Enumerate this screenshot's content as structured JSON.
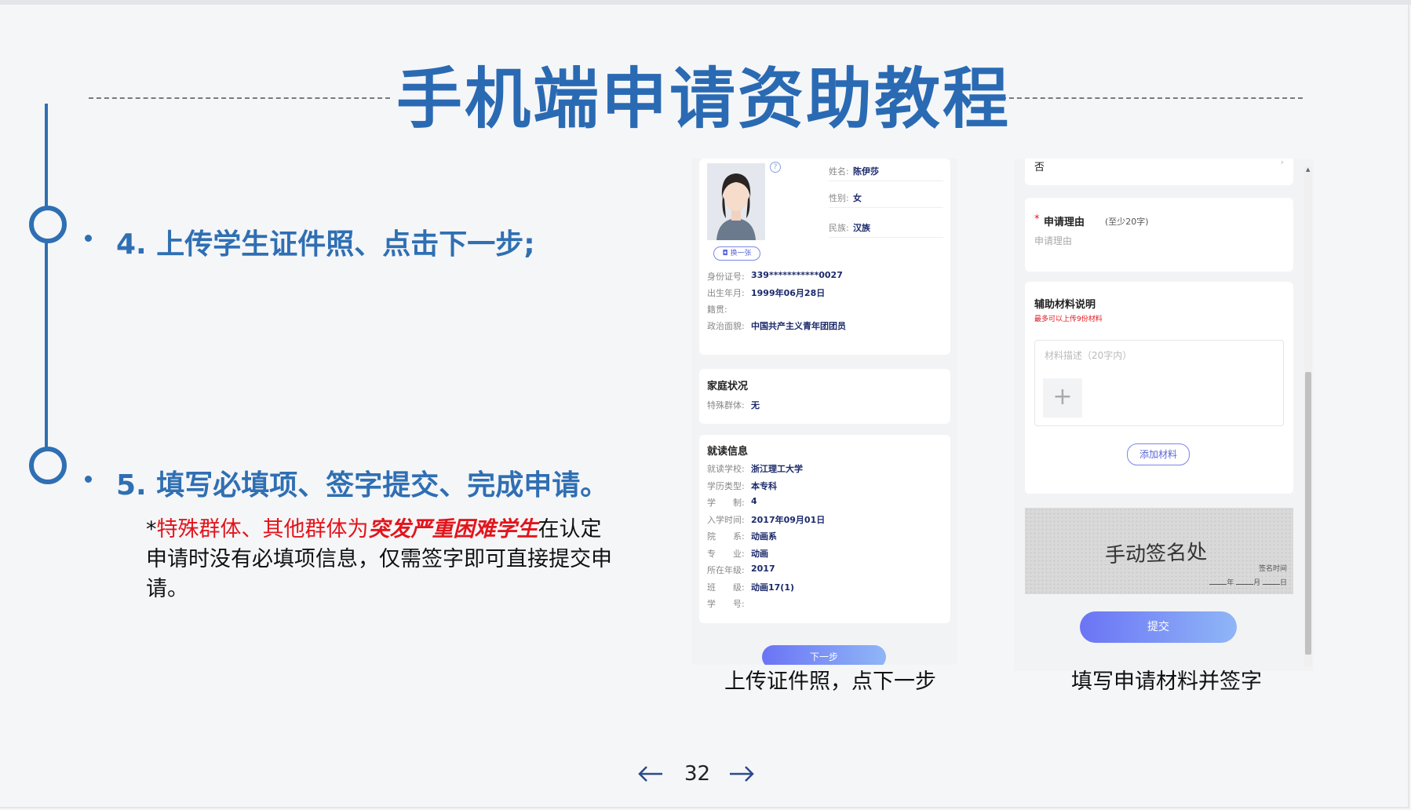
{
  "title": "手机端申请资助教程",
  "steps": [
    {
      "text": "4. 上传学生证件照、点击下一步;"
    },
    {
      "text": "5. 填写必填项、签字提交、完成申请。"
    }
  ],
  "note": {
    "star": "*",
    "red1": "特殊群体、其他群体为",
    "red_bold": "突发严重困难学生",
    "rest": "在认定申请时没有必填项信息，仅需签字即可直接提交申请。"
  },
  "shot1": {
    "help_icon": "?",
    "name_label": "姓名:",
    "name_value": "陈伊莎",
    "gender_label": "性别:",
    "gender_value": "女",
    "ethnic_label": "民族:",
    "ethnic_value": "汉族",
    "photo_button": "换一张",
    "id_label": "身份证号:",
    "id_value": "339***********0027",
    "birth_label": "出生年月:",
    "birth_value": "1999年06月28日",
    "native_label": "籍贯:",
    "political_label": "政治面貌:",
    "political_value": "中国共产主义青年团团员",
    "family_title": "家庭状况",
    "group_label": "特殊群体:",
    "group_value": "无",
    "study_title": "就读信息",
    "study_rows": [
      {
        "label": "就读学校:",
        "value": "浙江理工大学"
      },
      {
        "label": "学历类型:",
        "value": "本专科"
      },
      {
        "label": "学　　制:",
        "value": "4"
      },
      {
        "label": "入学时间:",
        "value": "2017年09月01日"
      },
      {
        "label": "院　　系:",
        "value": "动画系"
      },
      {
        "label": "专　　业:",
        "value": "动画"
      },
      {
        "label": "所在年级:",
        "value": "2017"
      },
      {
        "label": "班　　级:",
        "value": "动画17(1)"
      },
      {
        "label": "学　　号:",
        "value": ""
      }
    ],
    "next_button": "下一步"
  },
  "shot2": {
    "top_partial": "否",
    "reason_star": "*",
    "reason_title": "申请理由",
    "reason_hint": "(至少20字)",
    "reason_placeholder": "申请理由",
    "material_title": "辅助材料说明",
    "material_limit": "最多可以上传9份材料",
    "material_placeholder": "材料描述（20字内）",
    "add_icon": "+",
    "add_button": "添加材料",
    "signature_text": "手动签名处",
    "sign_time_label": "签名时间",
    "date_year": "年",
    "date_month": "月",
    "date_day": "日",
    "submit_button": "提交"
  },
  "captions": [
    "上传证件照，点下一步",
    "填写申请材料并签字"
  ],
  "pager": {
    "page": "32"
  },
  "colors": {
    "accent": "#2f6fb3",
    "red": "#e3141b",
    "button_start": "#6b74f5",
    "button_end": "#8fb6f7"
  }
}
